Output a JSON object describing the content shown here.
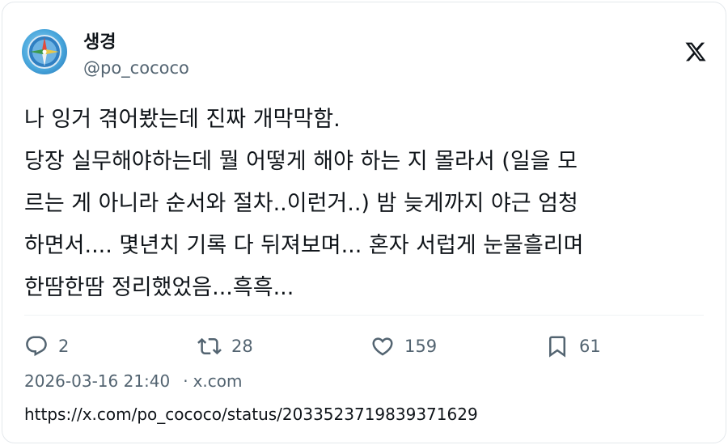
{
  "author": {
    "display_name": "생경",
    "handle": "@po_cococo",
    "avatar_icon": "compass-icon"
  },
  "brand": {
    "logo_icon": "x-logo-icon"
  },
  "tweet": {
    "lines": [
      "나 잉거 겪어봤는데 진짜 개막막함.",
      "당장 실무해야하는데 뭘 어떻게 해야 하는 지 몰라서 (일을 모",
      "르는 게 아니라 순서와 절차..이런거..) 밤 늦게까지 야근 엄청",
      "하면서.... 몇년치 기록 다 뒤져보며... 혼자 서럽게 눈물흘리며",
      "한땀한땀 정리했었음...흑흑..."
    ]
  },
  "actions": {
    "reply": {
      "icon": "reply-icon",
      "count": "2"
    },
    "repost": {
      "icon": "repost-icon",
      "count": "28"
    },
    "like": {
      "icon": "heart-icon",
      "count": "159"
    },
    "bookmark": {
      "icon": "bookmark-icon",
      "count": "61"
    }
  },
  "meta": {
    "timestamp": "2026-03-16 21:40",
    "separator": "·",
    "source": "x.com",
    "url": "https://x.com/po_cococo/status/2033523719839371629"
  },
  "colors": {
    "text_primary": "#0f1419",
    "text_secondary": "#536471",
    "border": "#e4e8ec"
  }
}
